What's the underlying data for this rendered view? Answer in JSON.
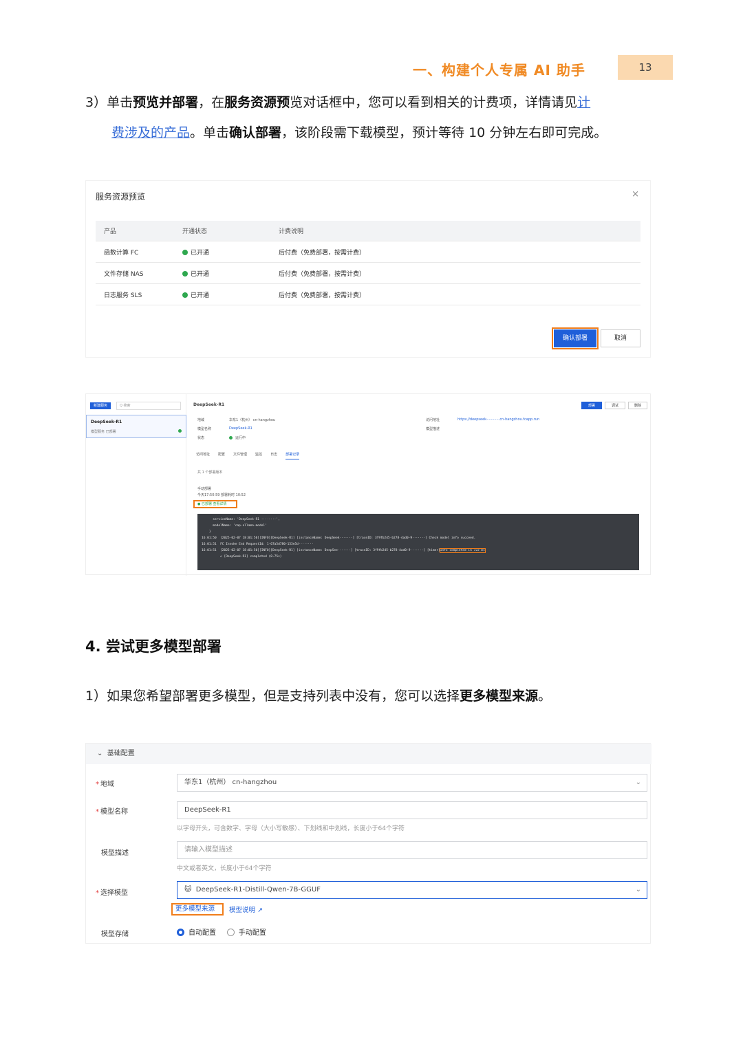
{
  "header": {
    "title": "一、构建个人专属 AI 助手",
    "page_number": "13"
  },
  "step3": {
    "prefix": "3）单击",
    "b1": "预览并部署",
    "t1": "，在",
    "b2": "服务资源预",
    "t2": "览对话框中，您可以看到相关的计费项，详情请见",
    "link_a": "计",
    "link_b": "费涉及的产品",
    "t3": "。单击",
    "b3": "确认部署",
    "t4": "，该阶段需下载模型，预计等待 10 分钟左右即可完成。"
  },
  "dialog": {
    "title": "服务资源预览",
    "close": "×",
    "columns": [
      "产品",
      "开通状态",
      "计费说明"
    ],
    "rows": [
      {
        "product": "函数计算 FC",
        "status": "已开通",
        "billing": "后付费（免费部署，按需计费）"
      },
      {
        "product": "文件存储 NAS",
        "status": "已开通",
        "billing": "后付费（免费部署，按需计费）"
      },
      {
        "product": "日志服务 SLS",
        "status": "已开通",
        "billing": "后付费（免费部署，按需计费）"
      }
    ],
    "confirm": "确认部署",
    "cancel": "取消"
  },
  "console": {
    "new_btn": "新建服务",
    "search": "Q 搜索",
    "item_name": "DeepSeek-R1",
    "item_sub": "模型服务 已部署",
    "service_name": "DeepSeek-R1",
    "btn_deploy": "部署",
    "btn_debug": "调试",
    "btn_delete": "删除",
    "region_k": "地域",
    "region_v": "华东1（杭州） cn-hangzhou",
    "model_k": "模型名称",
    "model_v": "DeepSeek-R1",
    "state_k": "状态",
    "state_v": "运行中",
    "access_k": "访问地址",
    "access_v": "https://deepseek-··········.cn-hangzhou.fcapp.run",
    "desc_k": "模型描述",
    "tabs": [
      "访问地址",
      "配置",
      "文件管理",
      "监控",
      "日志",
      "部署记录"
    ],
    "count": "共 1 个部署版本",
    "deploy_title": "手动部署",
    "deploy_time": "今天17:50:59  部署耗时 10:52",
    "badge": "● 已部署  查看详情",
    "log": "      serviceName: 'DeepSeek-R1 ········',\n      modelName: 'cap-ollama-model'\n    }\n16:01:50  [2025-02-07 18:01:50][INFO][DeepSeek-R1] [instanceName: DeepSeek·······] [traceID: 3f9fb245-b278-4ad0-9·······] Check model info succeed.\n16:01:51  FC Invoke End RequestId: 1-67a5d780-153e5d········\n16:01:51  [2025-02-07 18:01:50][INFO][DeepSeek-R1] [instanceName: DeepSee·······] [traceID: 3f9fb245-b278-4ad0-9·······] [timer]",
    "log_hl": "Info completed in 722 ms",
    "log_end": "          ✔ [DeepSeek-R1] completed (0.75s)"
  },
  "section4": {
    "heading": "4. 尝试更多模型部署"
  },
  "step1": {
    "prefix": "1）如果您希望部署更多模型，但是支持列表中没有，您可以选择",
    "bold": "更多模型来源",
    "suffix": "。"
  },
  "form": {
    "section": "基础配置",
    "region_label": "地域",
    "region_value": "华东1（杭州）  cn-hangzhou",
    "name_label": "模型名称",
    "name_value": "DeepSeek-R1",
    "name_hint": "以字母开头，可含数字、字母（大小写敏感）、下划线和中划线，长度小于64个字符",
    "desc_label": "模型描述",
    "desc_placeholder": "请输入模型描述",
    "desc_hint": "中文或者英文，长度小于64个字符",
    "select_label": "选择模型",
    "select_value": "DeepSeek-R1-Distill-Qwen-7B-GGUF",
    "more_source": "更多模型来源",
    "model_doc": "模型说明",
    "storage_label": "模型存储",
    "opt_auto": "自动配置",
    "opt_manual": "手动配置"
  }
}
